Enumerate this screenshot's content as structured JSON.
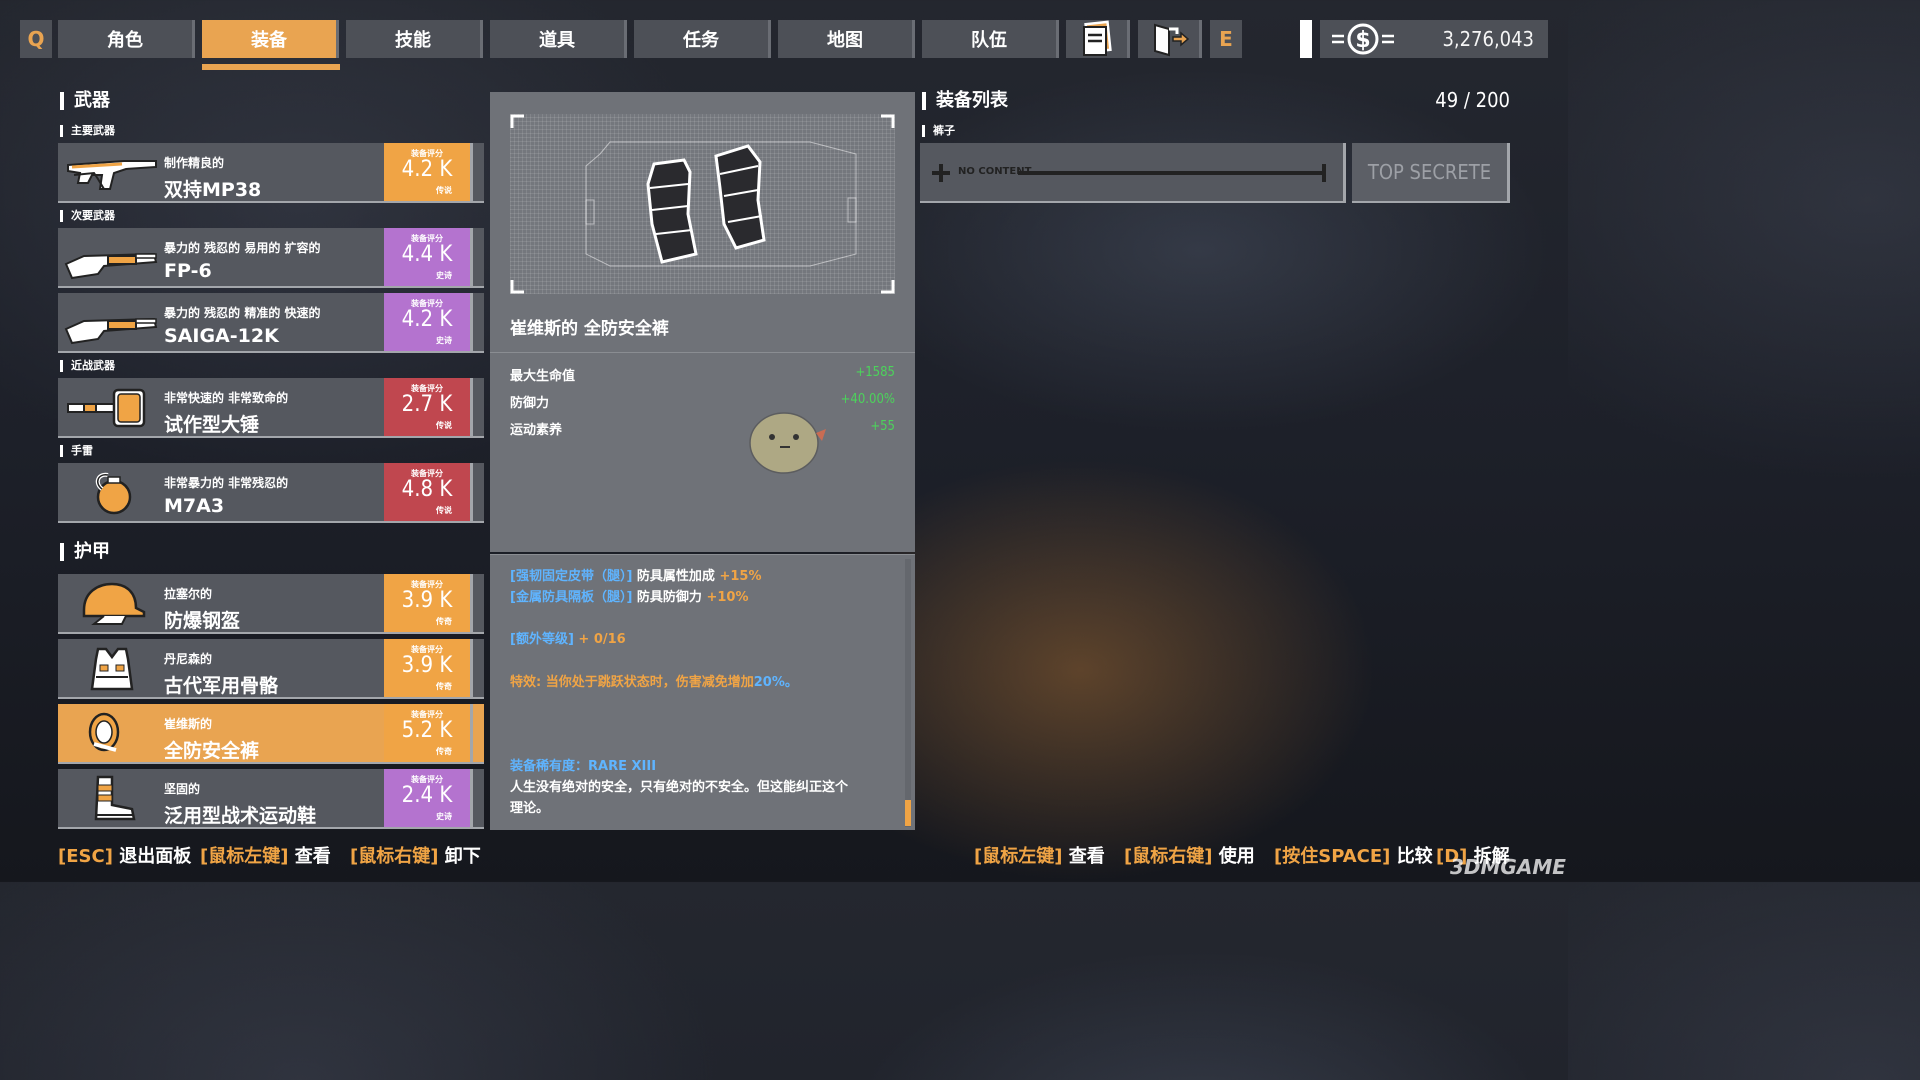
{
  "nav": {
    "left_key": "Q",
    "right_key": "E",
    "tabs": [
      {
        "label": "角色",
        "active": false
      },
      {
        "label": "装备",
        "active": true
      },
      {
        "label": "技能",
        "active": false
      },
      {
        "label": "道具",
        "active": false
      },
      {
        "label": "任务",
        "active": false
      },
      {
        "label": "地图",
        "active": false
      },
      {
        "label": "队伍",
        "active": false
      }
    ],
    "icons": [
      "notes-icon",
      "exit-door-icon"
    ],
    "currency_icon": "dollar-coin-icon",
    "currency_amount": "3,276,043"
  },
  "left": {
    "weapons_title": "武器",
    "primary_label": "主要武器",
    "secondary_label": "次要武器",
    "melee_label": "近战武器",
    "grenade_label": "手雷",
    "armor_title": "护甲",
    "score_label": "装备评分",
    "weapons": [
      {
        "icon": "smg-icon",
        "modifiers": "制作精良的",
        "name": "双持MP38",
        "score": "4.2 K",
        "rarity": "传说",
        "color": "orange"
      },
      {
        "icon": "shotgun-icon",
        "modifiers": "暴力的 残忍的 易用的 扩容的",
        "name": "FP-6",
        "score": "4.4 K",
        "rarity": "史诗",
        "color": "purple"
      },
      {
        "icon": "shotgun-icon",
        "modifiers": "暴力的 残忍的 精准的 快速的",
        "name": "SAIGA-12K",
        "score": "4.2 K",
        "rarity": "史诗",
        "color": "purple"
      },
      {
        "icon": "hammer-icon",
        "modifiers": "非常快速的 非常致命的",
        "name": "试作型大锤",
        "score": "2.7 K",
        "rarity": "传说",
        "color": "red"
      },
      {
        "icon": "grenade-icon",
        "modifiers": "非常暴力的 非常残忍的",
        "name": "M7A3",
        "score": "4.8 K",
        "rarity": "传说",
        "color": "red"
      }
    ],
    "armor": [
      {
        "icon": "helmet-icon",
        "modifiers": "拉塞尔的",
        "name": "防爆钢盔",
        "score": "3.9 K",
        "rarity": "传奇",
        "color": "orange"
      },
      {
        "icon": "vest-icon",
        "modifiers": "丹尼森的",
        "name": "古代军用骨骼",
        "score": "3.9 K",
        "rarity": "传奇",
        "color": "orange"
      },
      {
        "icon": "kneepad-icon",
        "modifiers": "崔维斯的",
        "name": "全防安全裤",
        "score": "5.2 K",
        "rarity": "传奇",
        "color": "orange"
      },
      {
        "icon": "boots-icon",
        "modifiers": "坚固的",
        "name": "泛用型战术运动鞋",
        "score": "2.4 K",
        "rarity": "史诗",
        "color": "purple"
      }
    ]
  },
  "detail": {
    "title": "崔维斯的 全防安全裤",
    "stats": [
      {
        "label": "最大生命值",
        "value": "+1585"
      },
      {
        "label": "防御力",
        "value": "+40.00%"
      },
      {
        "label": "运动素养",
        "value": "+55"
      }
    ],
    "desc": {
      "line1_key": "[强韧固定皮带（腿）]",
      "line1_text": "防具属性加成",
      "line1_val": "+15%",
      "line2_key": "[金属防具隔板（腿）]",
      "line2_text": "防具防御力",
      "line2_val": "+10%",
      "extra_key": "[额外等级]",
      "extra_val": "+ 0/16",
      "special_text": "特效: 当你处于跳跃状态时，伤害减免增加",
      "special_val": "20%。",
      "rarity_label": "装备稀有度：",
      "rarity_val": "RARE XIII",
      "flavor1": "人生没有绝对的安全，只有绝对的不安全。但这能纠正这个",
      "flavor2": "理论。"
    }
  },
  "right": {
    "title": "装备列表",
    "count": "49 / 200",
    "category": "裤子",
    "empty_label": "NO CONTENT",
    "locked_label": "TOP SECRETE"
  },
  "footer": {
    "left": [
      {
        "key": "[ESC]",
        "text": "退出面板"
      },
      {
        "key": "[鼠标左键]",
        "text": "查看"
      },
      {
        "key": "[鼠标右键]",
        "text": "卸下"
      }
    ],
    "right": [
      {
        "key": "[鼠标左键]",
        "text": "查看"
      },
      {
        "key": "[鼠标右键]",
        "text": "使用"
      },
      {
        "key": "[按住SPACE]",
        "text": "比较"
      },
      {
        "key": "[D]",
        "text": "拆解"
      }
    ],
    "watermark": "3DMGAME"
  },
  "colors": {
    "accent": "#e9a451",
    "epic": "#b473cf",
    "legend_red": "#c0474f",
    "stat_green": "#4cd35b",
    "link_blue": "#5fb4ff"
  }
}
